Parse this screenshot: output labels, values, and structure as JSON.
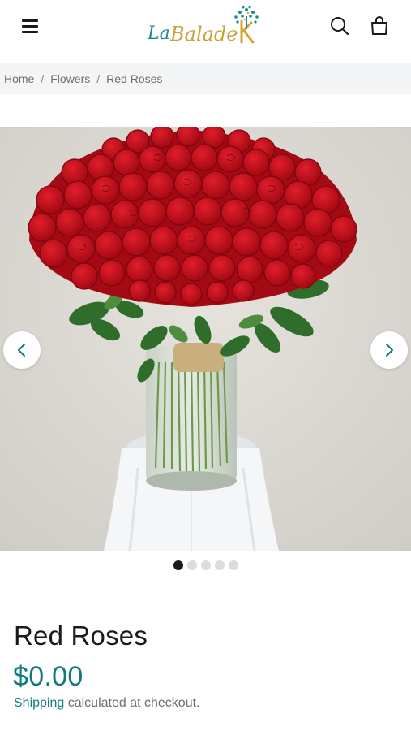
{
  "header": {
    "brand_name": "La Balade",
    "menu_icon": "hamburger-menu-icon",
    "search_icon": "search-icon",
    "cart_icon": "shopping-bag-icon"
  },
  "breadcrumb": {
    "items": [
      "Home",
      "Flowers",
      "Red Roses"
    ],
    "separator": "/"
  },
  "gallery": {
    "image_subject": "Red roses in glass vase",
    "prev_icon": "chevron-left-icon",
    "next_icon": "chevron-right-icon",
    "slide_count": 5,
    "active_slide": 1
  },
  "product": {
    "title": "Red Roses",
    "price": "$0.00",
    "shipping_link": "Shipping",
    "shipping_suffix": " calculated at checkout."
  },
  "colors": {
    "accent": "#0f7b80",
    "rose": "#c4101c",
    "breadcrumb_bg": "#f4f5f7"
  }
}
